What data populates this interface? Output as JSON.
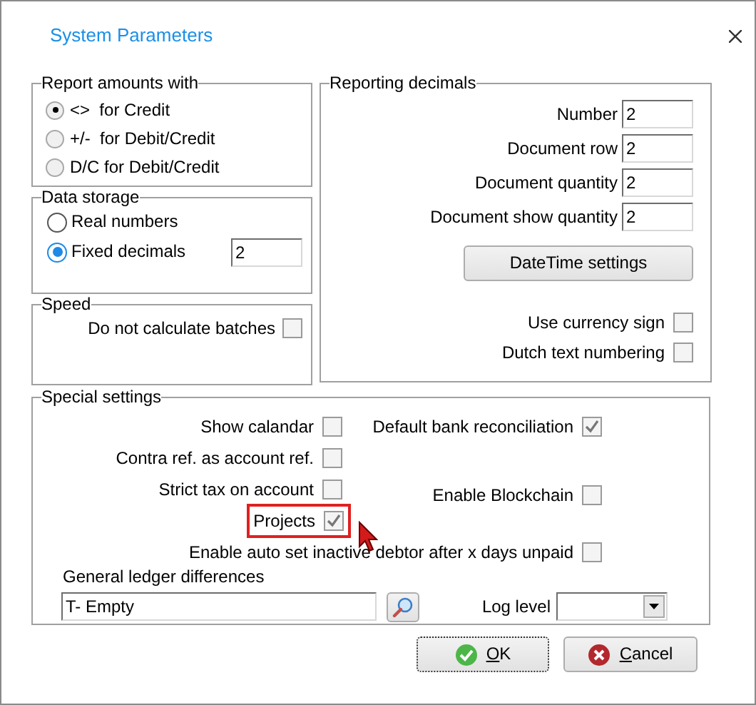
{
  "window": {
    "title": "System Parameters"
  },
  "report_amounts": {
    "legend": "Report amounts with",
    "disabled": true,
    "options": [
      {
        "label": "<>  for Credit",
        "selected": true
      },
      {
        "label": "+/-  for Debit/Credit",
        "selected": false
      },
      {
        "label": "D/C for Debit/Credit",
        "selected": false
      }
    ]
  },
  "data_storage": {
    "legend": "Data storage",
    "decimals": "2",
    "options": [
      {
        "label": "Real numbers",
        "selected": false
      },
      {
        "label": "Fixed decimals",
        "selected": true
      }
    ]
  },
  "speed": {
    "legend": "Speed",
    "checks": [
      {
        "label": "Do not calculate batches",
        "checked": false
      }
    ]
  },
  "reporting_decimals": {
    "legend": "Reporting decimals",
    "fields": [
      {
        "label": "Number",
        "value": "2"
      },
      {
        "label": "Document row",
        "value": "2"
      },
      {
        "label": "Document quantity",
        "value": "2"
      },
      {
        "label": "Document show quantity",
        "value": "2"
      }
    ],
    "button": "DateTime settings",
    "checks": [
      {
        "label": "Use currency sign",
        "checked": false
      },
      {
        "label": "Dutch text numbering",
        "checked": false
      }
    ]
  },
  "special_settings": {
    "legend": "Special settings",
    "rows": [
      {
        "left": {
          "label": "Show calandar",
          "checked": false
        },
        "right": {
          "label": "Default bank reconciliation",
          "checked": true
        }
      },
      {
        "left": {
          "label": "Contra ref. as account ref.",
          "checked": false
        }
      },
      {
        "left": {
          "label": "Strict tax on account",
          "checked": false
        },
        "right": {
          "label": "Enable Blockchain",
          "checked": false
        }
      },
      {
        "left": {
          "label": "Projects",
          "checked": true,
          "highlighted": true
        }
      },
      {
        "wide": {
          "label": "Enable auto set inactive debtor after x days unpaid",
          "checked": false
        }
      }
    ],
    "ledger": {
      "label": "General ledger differences",
      "value": "T- Empty"
    },
    "log_level": {
      "label": "Log level"
    }
  },
  "buttons": [
    {
      "label": "OK",
      "kind": "ok"
    },
    {
      "label": "Cancel",
      "kind": "cancel"
    }
  ]
}
